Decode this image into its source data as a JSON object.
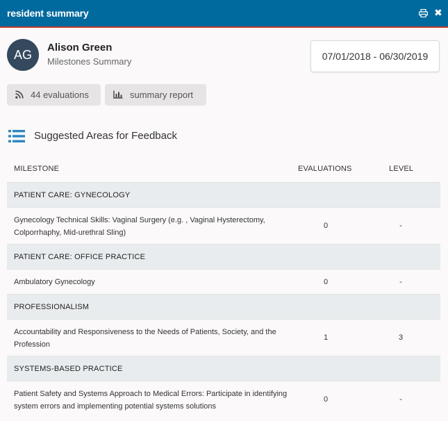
{
  "window": {
    "title": "resident summary",
    "print_icon": "print-icon",
    "close_icon": "close-icon",
    "close_glyph": "✖"
  },
  "resident": {
    "initials": "AG",
    "name": "Alison Green",
    "subtitle": "Milestones Summary",
    "date_range": "07/01/2018 - 06/30/2019"
  },
  "actions": {
    "evaluations_label": "44 evaluations",
    "evaluations_icon": "rss-icon",
    "report_label": "summary report",
    "report_icon": "bar-chart-icon"
  },
  "feedback": {
    "title": "Suggested Areas for Feedback",
    "icon": "list-icon"
  },
  "table": {
    "headers": {
      "milestone": "MILESTONE",
      "evaluations": "EVALUATIONS",
      "level": "LEVEL"
    },
    "groups": [
      {
        "name": "PATIENT CARE: GYNECOLOGY",
        "rows": [
          {
            "milestone": "Gynecology Technical Skills: Vaginal Surgery (e.g. , Vaginal Hysterectomy, Colporrhaphy, Mid-urethral Sling)",
            "evaluations": "0",
            "level": "-"
          }
        ]
      },
      {
        "name": "PATIENT CARE: OFFICE PRACTICE",
        "rows": [
          {
            "milestone": "Ambulatory Gynecology",
            "evaluations": "0",
            "level": "-"
          }
        ]
      },
      {
        "name": "PROFESSIONALISM",
        "rows": [
          {
            "milestone": "Accountability and Responsiveness to the Needs of Patients, Society, and the Profession",
            "evaluations": "1",
            "level": "3"
          }
        ]
      },
      {
        "name": "SYSTEMS-BASED PRACTICE",
        "rows": [
          {
            "milestone": "Patient Safety and Systems Approach to Medical Errors: Participate in identifying system errors and implementing potential systems solutions",
            "evaluations": "0",
            "level": "-"
          }
        ]
      }
    ]
  },
  "colors": {
    "titlebar": "#006a9e",
    "titlebar_border": "#c0392b",
    "avatar": "#34495e",
    "accent_icon": "#2e86c1",
    "group_row": "#e9ecee",
    "pill": "#e6e4e4"
  }
}
